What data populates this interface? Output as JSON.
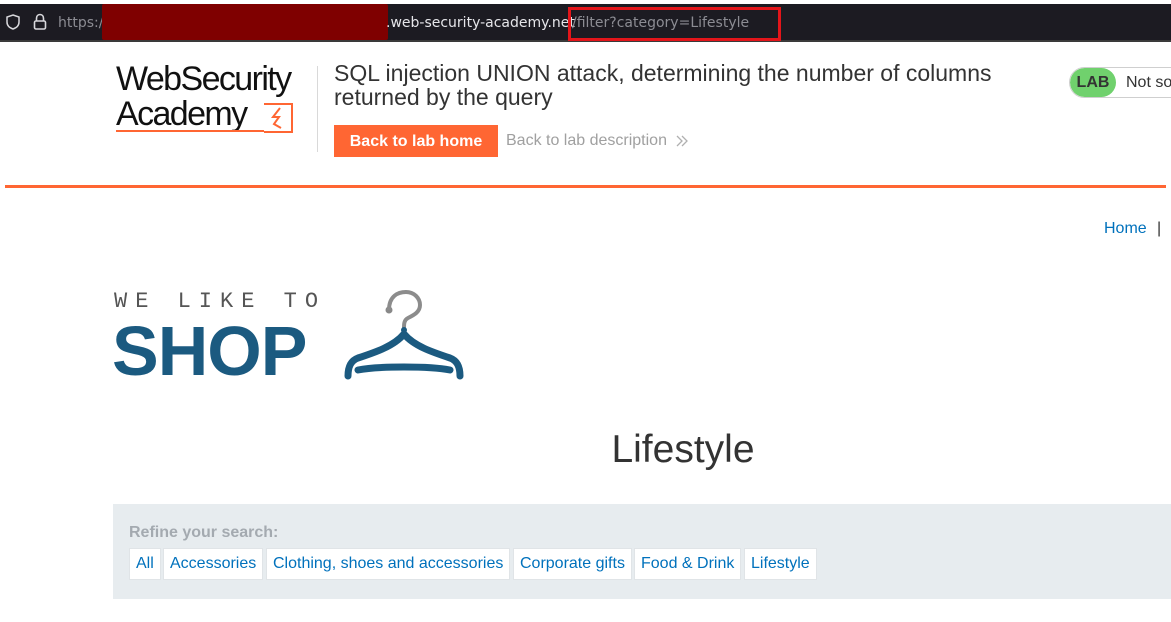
{
  "browser": {
    "url_scheme": "https:/",
    "url_domain": ".web-security-academy.net",
    "url_path": "/filter?category=Lifestyle"
  },
  "academy_header": {
    "logo_line1": "WebSecurity",
    "logo_line2": "Academy",
    "lab_title": "SQL injection UNION attack, determining the number of columns returned by the query",
    "back_home_label": "Back to lab home",
    "back_description_label": "Back to lab description",
    "lab_badge": "LAB",
    "lab_status": "Not solved"
  },
  "nav": {
    "home": "Home",
    "separator": "|"
  },
  "shop_logo": {
    "tagline": "WE LIKE TO",
    "wordmark": "SHOP"
  },
  "page": {
    "category_title": "Lifestyle"
  },
  "filter": {
    "refine_label": "Refine your search:",
    "categories": [
      "All",
      "Accessories",
      "Clothing, shoes and accessories",
      "Corporate gifts",
      "Food & Drink",
      "Lifestyle"
    ]
  },
  "colors": {
    "accent_orange": "#ff6633",
    "link_blue": "#0071bc",
    "shop_blue": "#1b5a80",
    "lab_green": "#70d16d"
  }
}
